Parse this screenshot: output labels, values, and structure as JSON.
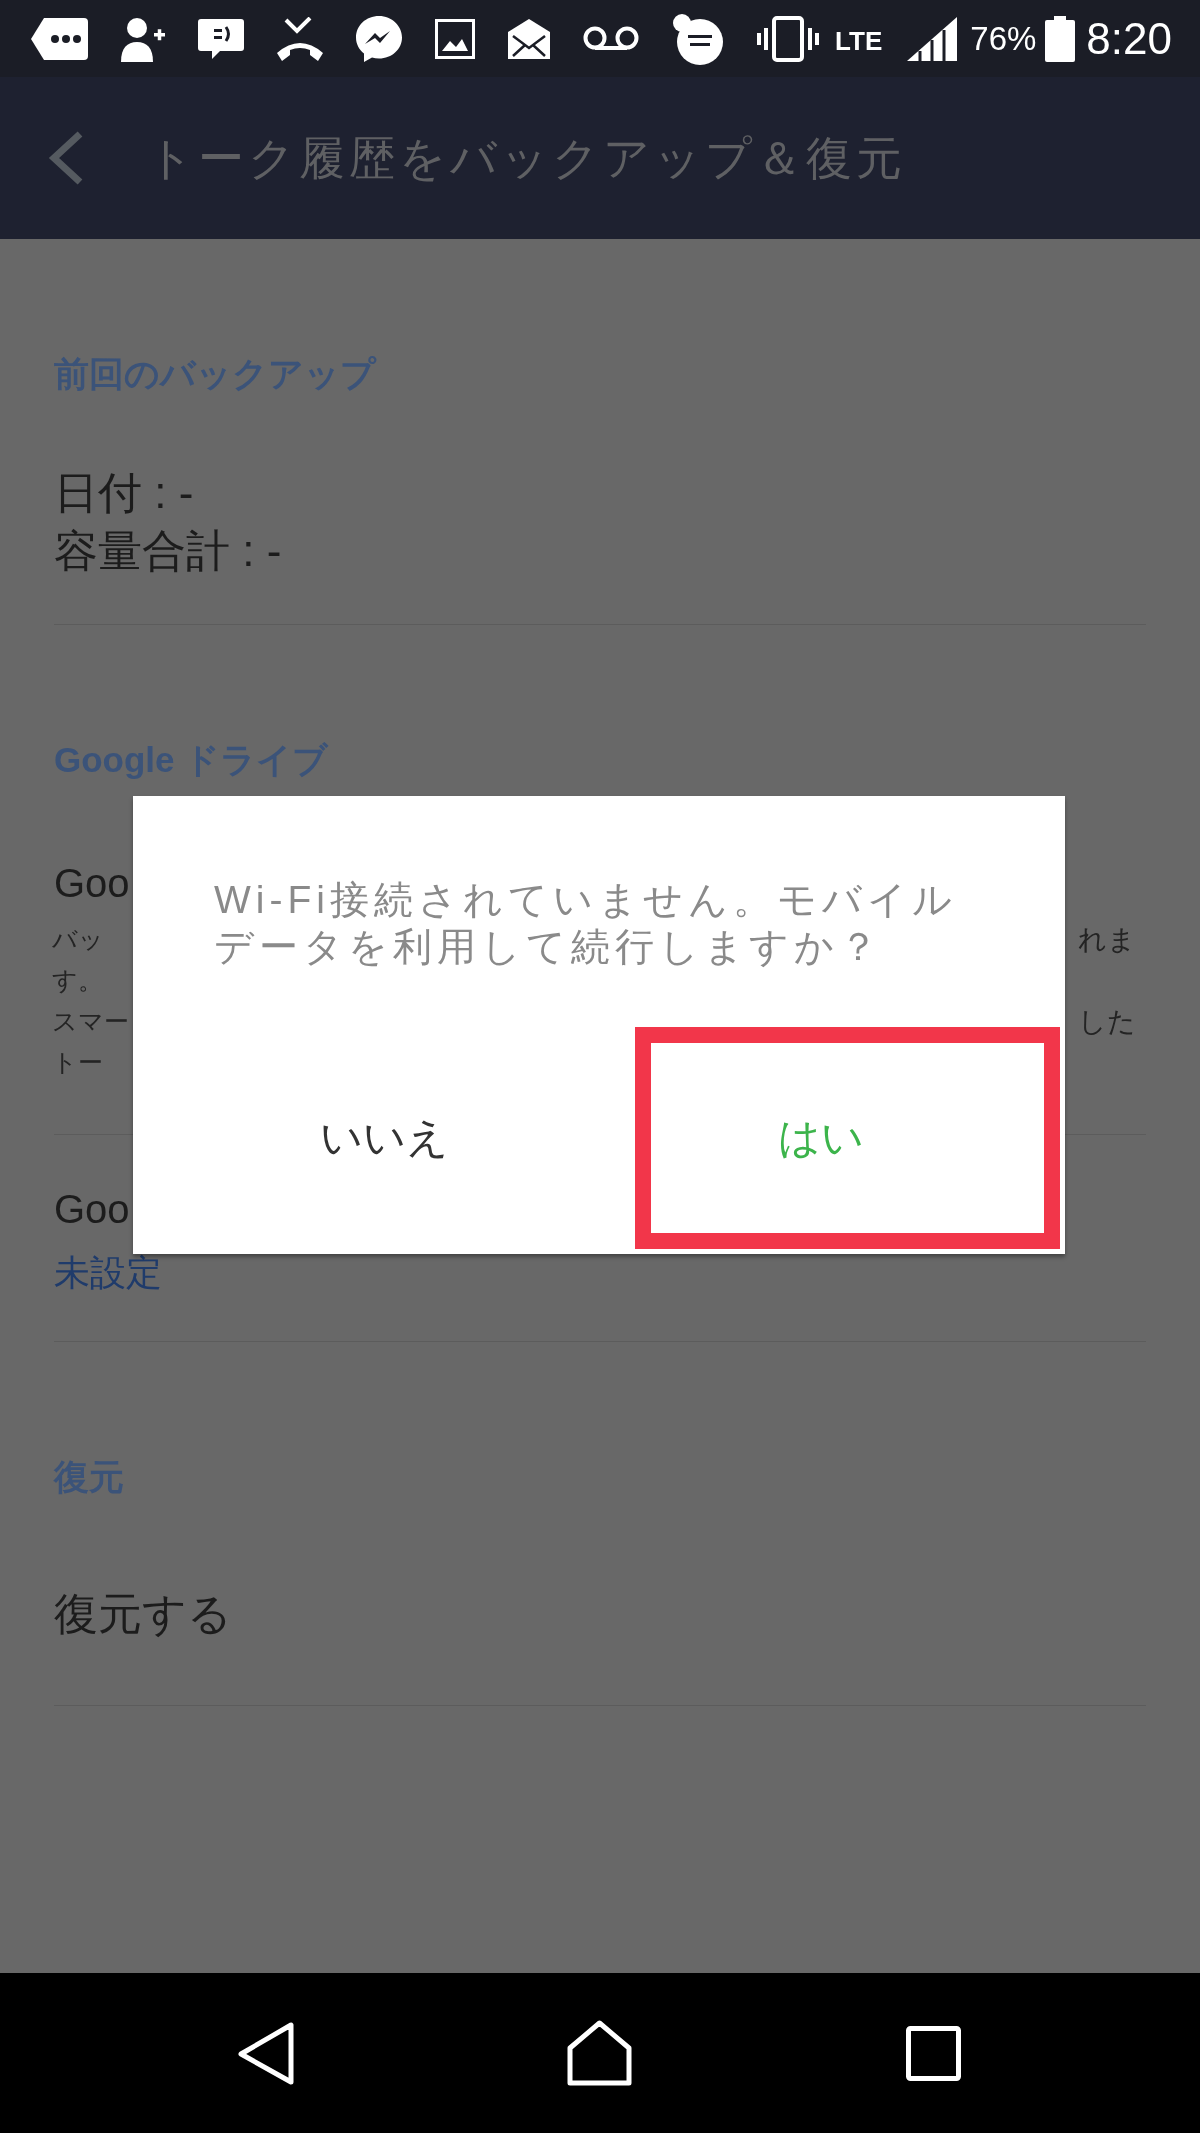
{
  "status_bar": {
    "network": "LTE",
    "battery": "76%",
    "time": "8:20"
  },
  "app_bar": {
    "title": "トーク履歴をバックアップ＆復元"
  },
  "sections": [
    {
      "header": "前回のバックアップ",
      "items": [
        {
          "kind": "stats",
          "lines": [
            "日付 : -",
            "容量合計 : -"
          ]
        }
      ]
    },
    {
      "header": "Google ドライブ",
      "items": [
        {
          "kind": "covered",
          "title": "Goo",
          "description_lines": [
            {
              "left": "バッ",
              "right": "れま"
            },
            {
              "left": "す。"
            },
            {
              "left": "スマー",
              "right": "した"
            },
            {
              "left": "トー"
            }
          ]
        },
        {
          "kind": "setting",
          "title": "Goo",
          "value": "未設定"
        }
      ]
    },
    {
      "header": "復元",
      "items": [
        {
          "kind": "action",
          "title": "復元する"
        }
      ]
    }
  ],
  "dialog": {
    "message": "Wi-Fi接続されていません。モバイルデータを利用して続行しますか？",
    "buttons": [
      {
        "label": "いいえ",
        "kind": "negative",
        "highlighted": false
      },
      {
        "label": "はい",
        "kind": "positive",
        "highlighted": true
      }
    ]
  }
}
